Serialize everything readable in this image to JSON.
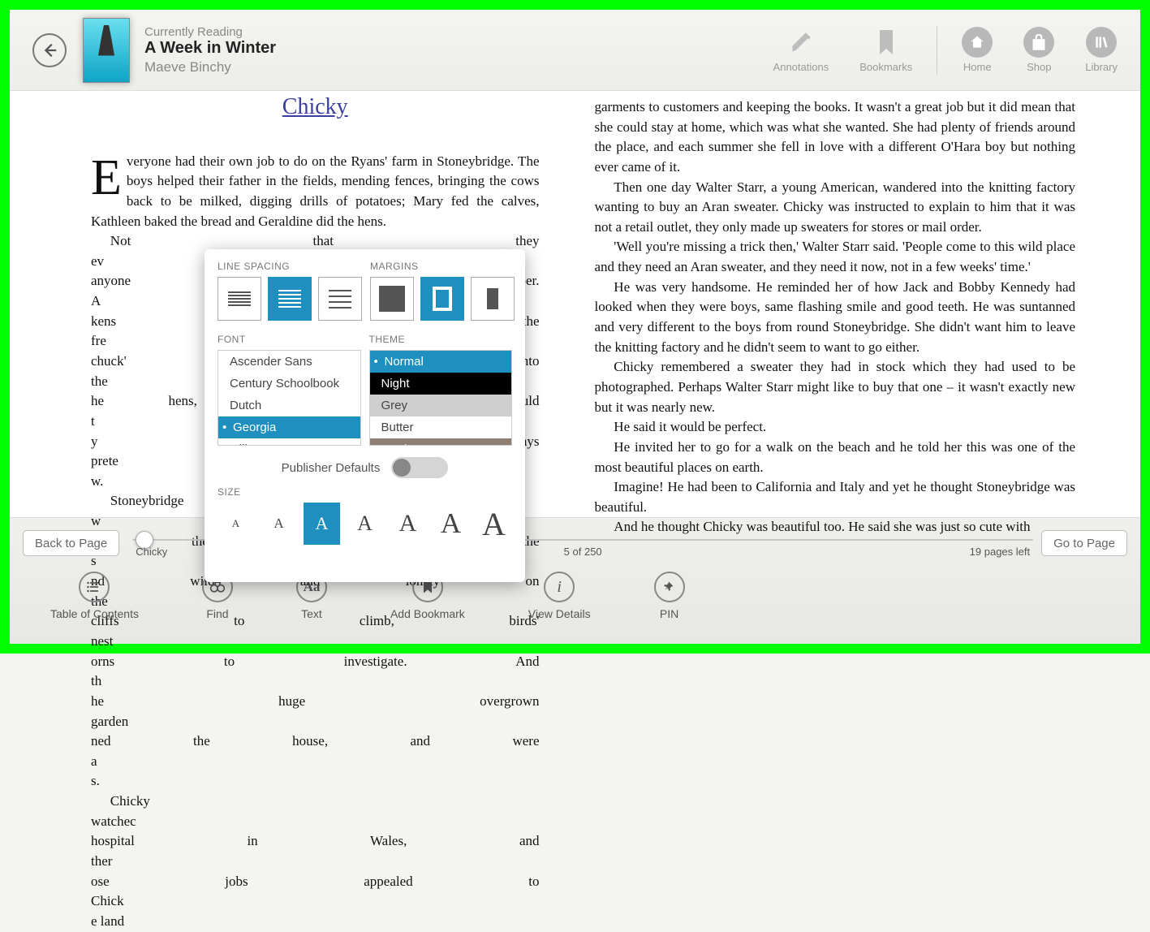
{
  "header": {
    "reading_label": "Currently Reading",
    "book_title": "A Week in Winter",
    "author": "Maeve Binchy",
    "actions": [
      {
        "id": "annotations",
        "label": "Annotations"
      },
      {
        "id": "bookmarks",
        "label": "Bookmarks"
      },
      {
        "id": "home",
        "label": "Home"
      },
      {
        "id": "shop",
        "label": "Shop"
      },
      {
        "id": "library",
        "label": "Library"
      }
    ]
  },
  "content": {
    "chapter_title": "Chicky",
    "left_paragraphs": [
      "veryone had their own job to do on the Ryans' farm in Stoneybridge. The boys helped their father in the fields, mending fences, bringing the cows back to be milked, digging drills of potatoes; Mary fed the calves, Kathleen baked the bread and Geraldine did the hens.",
      "Not that they ev                                    anyone could remember. A                                    kens or collecting the fre                                     chuck' soothingly into the                                    he hens, and no one could t                                    y lunch. They always prete                                    w.",
      "Stoneybridge w                                    ing the summer, but the s                                    nd wild and lonely on the                                    cliffs to climb, birds' nest                                    orns to investigate. And th                                    he huge overgrown garden                                    ned the house, and were a                                    s.",
      "Chicky watchec                                    hospital in Wales, and ther                                    ose jobs appealed to Chick                                    e land"
    ],
    "right_paragraphs": [
      "garments to customers and keeping the books. It wasn't a great job but it did mean that she could stay at home, which was what she wanted. She had plenty of friends around the place, and each summer she fell in love with a different O'Hara boy but nothing ever came of it.",
      "Then one day Walter Starr, a young American, wandered into the knitting factory wanting to buy an Aran sweater. Chicky was instructed to explain to him that it was not a retail outlet, they only made up sweaters for stores or mail order.",
      "'Well you're missing a trick then,' Walter Starr said. 'People come to this wild place and they need an Aran sweater, and they need it now, not in a few weeks' time.'",
      "He was very handsome. He reminded her of how Jack and Bobby Kennedy had looked when they were boys, same flashing smile and good teeth. He was suntanned and very different to the boys from round Stoneybridge. She didn't want him to leave the knitting factory and he didn't seem to want to go either.",
      "Chicky remembered a sweater they had in stock which they had used to be photographed. Perhaps Walter Starr might like to buy that one – it wasn't exactly new but it was nearly new.",
      "He said it would be perfect.",
      "He invited her to go for a walk on the beach and he told her this was one of the most beautiful places on earth.",
      "Imagine! He had been to California and Italy and yet he thought Stoneybridge was beautiful.",
      "And he thought Chicky was beautiful too. He said she was just so cute with"
    ]
  },
  "pager": {
    "back_label": "Back to Page",
    "go_label": "Go to Page",
    "chapter_name": "Chicky",
    "position": "5 of 250",
    "pages_left": "19 pages left"
  },
  "toolbar": [
    {
      "id": "toc",
      "label": "Table of Contents"
    },
    {
      "id": "find",
      "label": "Find"
    },
    {
      "id": "text",
      "label": "Text"
    },
    {
      "id": "add-bookmark",
      "label": "Add Bookmark"
    },
    {
      "id": "view-details",
      "label": "View Details"
    },
    {
      "id": "pin",
      "label": "PIN"
    }
  ],
  "text_settings": {
    "line_spacing_label": "LINE SPACING",
    "margins_label": "MARGINS",
    "font_label": "FONT",
    "theme_label": "THEME",
    "size_label": "SIZE",
    "publisher_defaults_label": "Publisher Defaults",
    "line_spacing_selected": 1,
    "margins_selected": 1,
    "fonts": [
      "Ascender Sans",
      "Century Schoolbook",
      "Dutch",
      "Georgia",
      "Gill Sans"
    ],
    "font_selected": "Georgia",
    "themes": [
      "Normal",
      "Night",
      "Grey",
      "Butter",
      "Mocha"
    ],
    "theme_selected": "Normal",
    "size_selected": 2,
    "size_count": 7
  }
}
